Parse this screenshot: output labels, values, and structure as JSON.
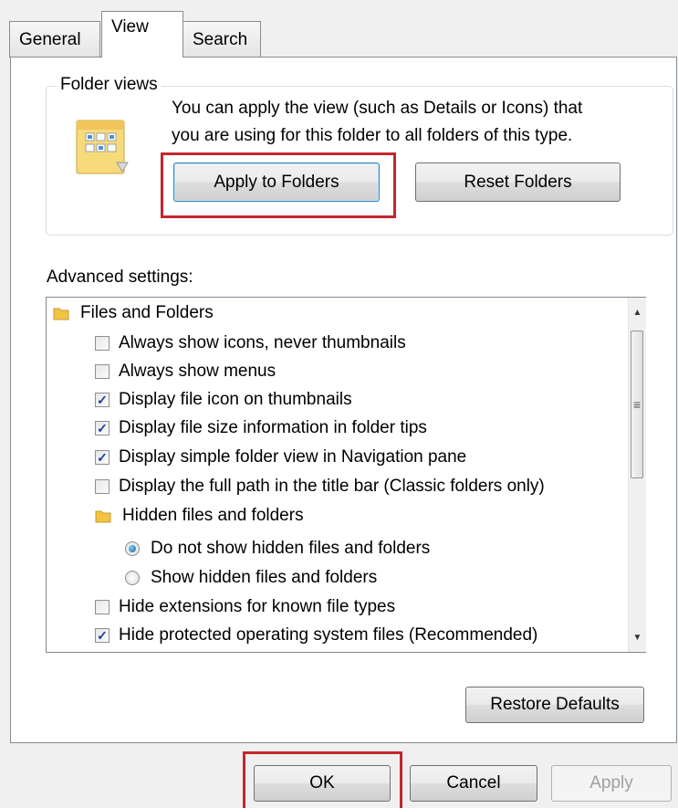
{
  "tabs": [
    {
      "label": "General",
      "active": false
    },
    {
      "label": "View",
      "active": true
    },
    {
      "label": "Search",
      "active": false
    }
  ],
  "folder_views": {
    "title": "Folder views",
    "description_line1": "You can apply the view (such as Details or Icons) that",
    "description_line2": "you are using for this folder to all folders of this type.",
    "icon": "folder-views-icon",
    "apply_button": "Apply to Folders",
    "reset_button": "Reset Folders"
  },
  "advanced": {
    "label": "Advanced settings:",
    "items": [
      {
        "type": "folder",
        "label": "Files and Folders"
      },
      {
        "type": "checkbox",
        "label": "Always show icons, never thumbnails",
        "checked": false
      },
      {
        "type": "checkbox",
        "label": "Always show menus",
        "checked": false
      },
      {
        "type": "checkbox",
        "label": "Display file icon on thumbnails",
        "checked": true
      },
      {
        "type": "checkbox",
        "label": "Display file size information in folder tips",
        "checked": true
      },
      {
        "type": "checkbox",
        "label": "Display simple folder view in Navigation pane",
        "checked": true
      },
      {
        "type": "checkbox",
        "label": "Display the full path in the title bar (Classic folders only)",
        "checked": false
      },
      {
        "type": "folder",
        "label": "Hidden files and folders"
      },
      {
        "type": "radio",
        "label": "Do not show hidden files and folders",
        "checked": true
      },
      {
        "type": "radio",
        "label": "Show hidden files and folders",
        "checked": false
      },
      {
        "type": "checkbox",
        "label": "Hide extensions for known file types",
        "checked": false
      },
      {
        "type": "checkbox",
        "label": "Hide protected operating system files (Recommended)",
        "checked": true
      }
    ],
    "restore_button": "Restore Defaults"
  },
  "dialog_buttons": {
    "ok": "OK",
    "cancel": "Cancel",
    "apply": "Apply"
  },
  "colors": {
    "highlight": "#c4262e",
    "checkmark": "#1b3e9c",
    "folder": "#f3c443"
  }
}
